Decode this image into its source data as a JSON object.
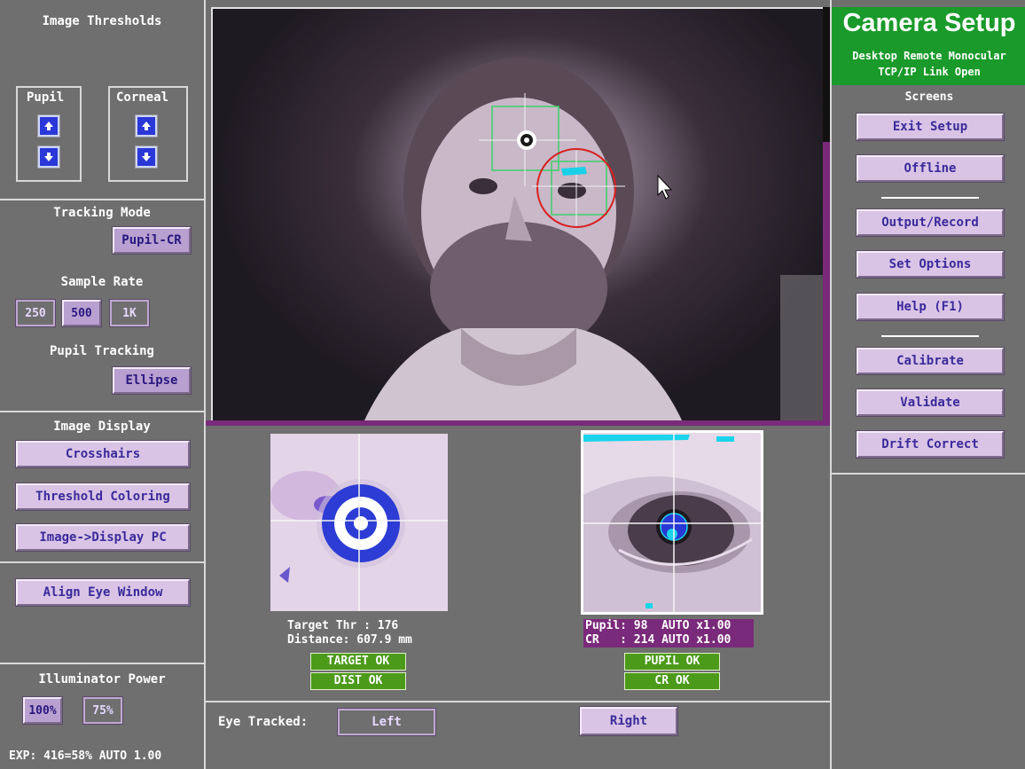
{
  "left": {
    "thresholds_title": "Image Thresholds",
    "pupil_label": "Pupil",
    "corneal_label": "Corneal",
    "tracking_mode_title": "Tracking Mode",
    "tracking_mode_value": "Pupil-CR",
    "sample_rate_title": "Sample Rate",
    "rates": [
      "250",
      "500",
      "1K"
    ],
    "pupil_tracking_title": "Pupil Tracking",
    "pupil_tracking_value": "Ellipse",
    "image_display_title": "Image Display",
    "crosshairs": "Crosshairs",
    "threshold_coloring": "Threshold Coloring",
    "image_display_pc": "Image->Display PC",
    "align_eye_window": "Align Eye Window",
    "illuminator_title": "Illuminator Power",
    "power": [
      "100%",
      "75%"
    ],
    "exp_status": "EXP: 416=58% AUTO 1.00"
  },
  "right": {
    "title": "Camera Setup",
    "subtitle1": "Desktop Remote Monocular",
    "subtitle2": "TCP/IP Link Open",
    "screens_label": "Screens",
    "buttons": [
      "Exit Setup",
      "Offline",
      "Output/Record",
      "Set Options",
      "Help (F1)",
      "Calibrate",
      "Validate",
      "Drift Correct"
    ]
  },
  "target": {
    "thr_line": "Target Thr : 176",
    "dist_line": "Distance: 607.9 mm",
    "target_ok": "TARGET OK",
    "dist_ok": "DIST  OK"
  },
  "eye": {
    "pupil_line": "Pupil: 98  AUTO x1.00",
    "cr_line": "CR   : 214 AUTO x1.00",
    "pupil_ok": "PUPIL OK",
    "cr_ok": "CR  OK"
  },
  "bottom": {
    "eye_tracked_label": "Eye Tracked:",
    "left": "Left",
    "right": "Right"
  },
  "colors": {
    "accent_purple": "#7a2a7a",
    "status_green": "#4c9a1a",
    "header_green": "#1a9a2a",
    "button_lilac": "#d9c4e6"
  }
}
